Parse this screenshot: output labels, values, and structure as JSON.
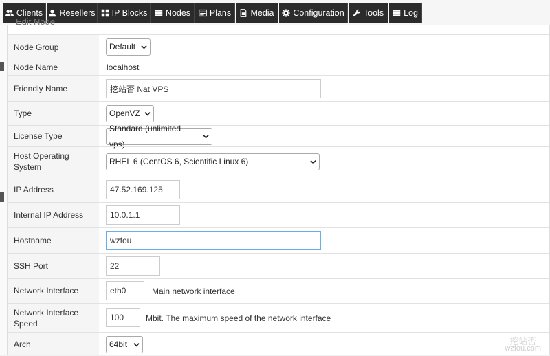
{
  "nav": [
    {
      "label": "Clients",
      "icon": "users-icon"
    },
    {
      "label": "Resellers",
      "icon": "user-icon"
    },
    {
      "label": "IP Blocks",
      "icon": "grid-icon"
    },
    {
      "label": "Nodes",
      "icon": "server-icon"
    },
    {
      "label": "Plans",
      "icon": "list-icon"
    },
    {
      "label": "Media",
      "icon": "file-icon"
    },
    {
      "label": "Configuration",
      "icon": "gear-icon"
    },
    {
      "label": "Tools",
      "icon": "wrench-icon"
    },
    {
      "label": "Log",
      "icon": "list-icon"
    }
  ],
  "panel": {
    "title": "Edit Node"
  },
  "form": {
    "node_group": {
      "label": "Node Group",
      "value": "Default"
    },
    "node_name": {
      "label": "Node Name",
      "value": "localhost"
    },
    "friendly_name": {
      "label": "Friendly Name",
      "value": "挖站否 Nat VPS"
    },
    "type": {
      "label": "Type",
      "value": "OpenVZ"
    },
    "license_type": {
      "label": "License Type",
      "value": "Standard (unlimited vps)"
    },
    "host_os": {
      "label": "Host Operating System",
      "value": "RHEL 6 (CentOS 6, Scientific Linux 6)"
    },
    "ip_address": {
      "label": "IP Address",
      "value": "47.52.169.125"
    },
    "internal_ip": {
      "label": "Internal IP Address",
      "value": "10.0.1.1"
    },
    "hostname": {
      "label": "Hostname",
      "value": "wzfou"
    },
    "ssh_port": {
      "label": "SSH Port",
      "value": "22"
    },
    "network_interface": {
      "label": "Network Interface",
      "value": "eth0",
      "hint": "Main network interface"
    },
    "network_speed": {
      "label": "Network Interface Speed",
      "value": "100",
      "hint": "Mbit. The maximum speed of the network interface"
    },
    "arch": {
      "label": "Arch",
      "value": "64bit"
    }
  },
  "watermark": {
    "line1": "挖站否",
    "line2": "wzfou.com"
  }
}
